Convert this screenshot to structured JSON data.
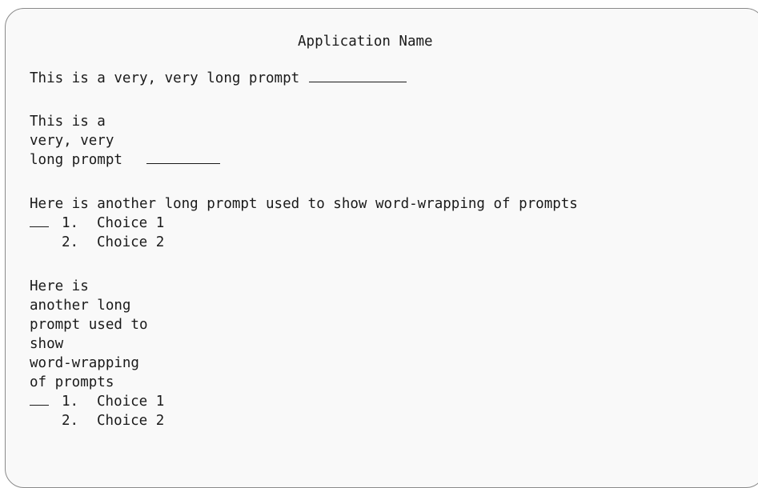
{
  "screen": {
    "title": "Application Name",
    "prompt1": {
      "label": "This is a very, very long prompt",
      "value": ""
    },
    "prompt2": {
      "lines": [
        "This is a",
        "very, very",
        "long prompt"
      ],
      "value": ""
    },
    "prompt3": {
      "label": "Here is another long prompt used to show word-wrapping of prompts",
      "value": "",
      "choices": [
        {
          "num": "1.",
          "label": "Choice 1"
        },
        {
          "num": "2.",
          "label": "Choice 2"
        }
      ]
    },
    "prompt4": {
      "lines": [
        "Here is",
        "another long",
        "prompt used to",
        "show",
        "word-wrapping",
        "of prompts"
      ],
      "value": "",
      "choices": [
        {
          "num": "1.",
          "label": "Choice 1"
        },
        {
          "num": "2.",
          "label": "Choice 2"
        }
      ]
    }
  }
}
